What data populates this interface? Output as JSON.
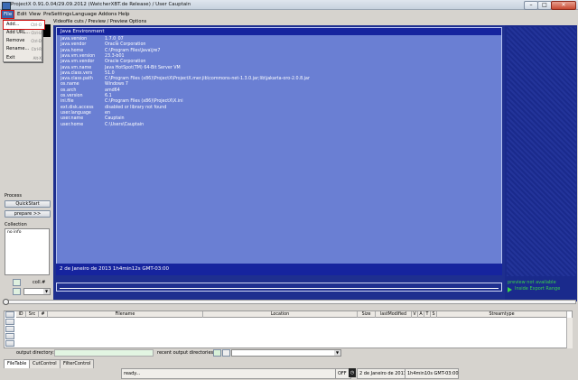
{
  "window": {
    "title": "ProjectX 0.91.0.04/29.09.2012 (WatcherXBT.de Release) / User Cauptain",
    "min": "–",
    "max": "□",
    "close": "✕"
  },
  "menubar": {
    "file": "File",
    "edit": "Edit",
    "view": "View",
    "presettings": "PreSettings",
    "language": "Language",
    "addons": "Addons",
    "help": "Help"
  },
  "file_menu": {
    "items": [
      {
        "label": "Add...",
        "shortcut": "Ctrl-O"
      },
      {
        "label": "Add URL...",
        "shortcut": "Ctrl-U"
      },
      {
        "label": "Remove",
        "shortcut": "Ctrl-D"
      },
      {
        "label": "Rename...",
        "shortcut": "Ctrl-R"
      },
      {
        "label": "Exit",
        "shortcut": "Alt-X"
      }
    ]
  },
  "left": {
    "process_label": "Process",
    "quickstart": "QuickStart",
    "prepare": "prepare >>",
    "collection_label": "Collection",
    "collection_text": "no info",
    "coll_label": "coll.#"
  },
  "tabs_header": "Videofile cuts / Preview / Preview Options",
  "env": {
    "header": "Java Environment",
    "rows": [
      {
        "k": "java.version",
        "v": "1.7.0_07"
      },
      {
        "k": "java.vendor",
        "v": "Oracle Corporation"
      },
      {
        "k": "java.home",
        "v": "C:\\Program Files\\Java\\jre7"
      },
      {
        "k": "java.vm.version",
        "v": "23.3-b01"
      },
      {
        "k": "java.vm.vendor",
        "v": "Oracle Corporation"
      },
      {
        "k": "java.vm.name",
        "v": "Java HotSpot(TM) 64-Bit Server VM"
      },
      {
        "k": "java.class.vers",
        "v": "51.0"
      },
      {
        "k": "java.class.path",
        "v": "C:\\Program Files (x86)\\ProjectX\\ProjectX.mer.jib\\commons-net-1.3.0.jar;lib\\jakarta-oro-2.0.8.jar"
      },
      {
        "k": "os.name",
        "v": "Windows 7"
      },
      {
        "k": "os.arch",
        "v": "amd64"
      },
      {
        "k": "os.version",
        "v": "6.1"
      },
      {
        "k": "ini.file",
        "v": "C:\\Program Files (x86)\\ProjectX\\X.ini"
      },
      {
        "k": "ext.disk.access",
        "v": "disabled or library not found"
      },
      {
        "k": "user.language",
        "v": "en"
      },
      {
        "k": "user.name",
        "v": "Cauptain"
      },
      {
        "k": "user.home",
        "v": "C:\\Users\\Cauptain"
      }
    ],
    "date_line": "2 de Janeiro de 2013    1h4min12s GMT-03:00"
  },
  "right": {
    "preview_na": "preview not available",
    "inside_export": "Inside Export Range"
  },
  "table": {
    "columns": [
      "ID",
      "Src",
      "#",
      "Filename",
      "Location",
      "Size",
      "lastModified",
      "V",
      "A",
      "T",
      "S",
      "Streamtype"
    ]
  },
  "output": {
    "dir_label": "output directory:",
    "recent_label": "recent output directories:"
  },
  "bottom_tabs": [
    "FileTable",
    "CutControl",
    "FilterControl"
  ],
  "status": {
    "text": "ready...",
    "off": "OFF",
    "date": "2 de Janeiro de 2013",
    "time": "1h4min10s GMT-03:00"
  },
  "colors": {
    "panel_bg": "#d6d3ce",
    "video_bg": "#1e2f8f",
    "env_bg": "#6a7fd3",
    "accent_green": "#3ad34a",
    "highlight_red": "#d01010"
  }
}
